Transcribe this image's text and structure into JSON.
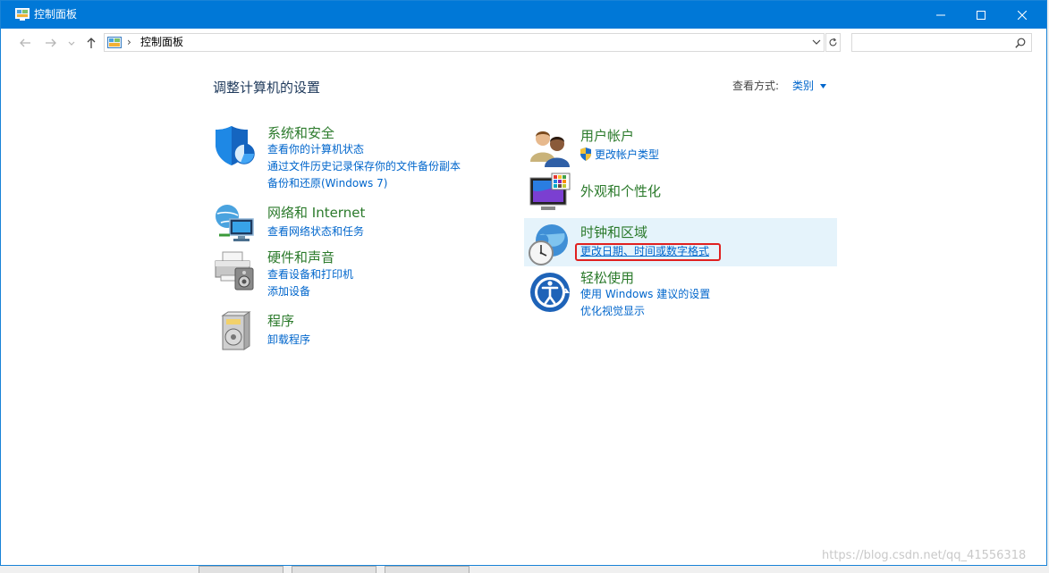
{
  "window": {
    "title": "控制面板",
    "controls": {
      "minimize": "—",
      "maximize": "☐",
      "close": "✕"
    }
  },
  "navbar": {
    "address_sep": "›",
    "address_text": "控制面板",
    "search_placeholder": ""
  },
  "main": {
    "heading": "调整计算机的设置",
    "view_by_label": "查看方式:",
    "view_by_value": "类别"
  },
  "left_categories": [
    {
      "title": "系统和安全",
      "icon": "shield-icon",
      "links": [
        "查看你的计算机状态",
        "通过文件历史记录保存你的文件备份副本",
        "备份和还原(Windows 7)"
      ]
    },
    {
      "title": "网络和 Internet",
      "icon": "network-icon",
      "links": [
        "查看网络状态和任务"
      ]
    },
    {
      "title": "硬件和声音",
      "icon": "printer-icon",
      "links": [
        "查看设备和打印机",
        "添加设备"
      ]
    },
    {
      "title": "程序",
      "icon": "programs-icon",
      "links": [
        "卸载程序"
      ]
    }
  ],
  "right_categories": [
    {
      "title": "用户帐户",
      "icon": "users-icon",
      "links": [
        "更改帐户类型"
      ]
    },
    {
      "title": "外观和个性化",
      "icon": "monitor-icon",
      "links": []
    },
    {
      "title": "时钟和区域",
      "icon": "clock-globe-icon",
      "links": [
        "更改日期、时间或数字格式"
      ]
    },
    {
      "title": "轻松使用",
      "icon": "ease-of-access-icon",
      "links": [
        "使用 Windows 建议的设置",
        "优化视觉显示"
      ]
    }
  ],
  "watermark": "https://blog.csdn.net/qq_41556318",
  "colors": {
    "titlebar": "#0078d7",
    "link": "#0066cc",
    "category_title": "#2b7a2b",
    "highlight": "#e5f3fb",
    "annotation": "#e02020"
  }
}
